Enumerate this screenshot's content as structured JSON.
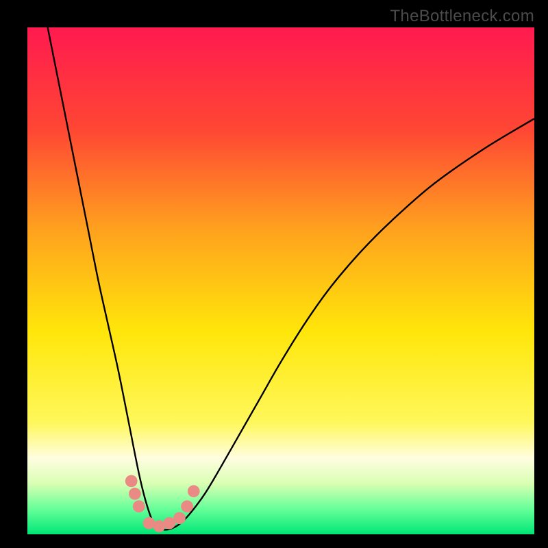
{
  "watermark": "TheBottleneck.com",
  "chart_data": {
    "type": "line",
    "title": "",
    "xlabel": "",
    "ylabel": "",
    "xlim": [
      0,
      100
    ],
    "ylim": [
      0,
      100
    ],
    "grid": false,
    "legend": false,
    "background_gradient": {
      "stops": [
        {
          "pos": 0.0,
          "color": "#ff1a4f"
        },
        {
          "pos": 0.2,
          "color": "#ff4634"
        },
        {
          "pos": 0.4,
          "color": "#ffa21e"
        },
        {
          "pos": 0.6,
          "color": "#ffe60a"
        },
        {
          "pos": 0.78,
          "color": "#fff85c"
        },
        {
          "pos": 0.85,
          "color": "#fffde0"
        },
        {
          "pos": 0.9,
          "color": "#d9ffb3"
        },
        {
          "pos": 0.95,
          "color": "#66ff99"
        },
        {
          "pos": 1.0,
          "color": "#00e676"
        }
      ]
    },
    "series": [
      {
        "name": "bottleneck-curve",
        "color": "#000000",
        "x": [
          4,
          6,
          8,
          10,
          12,
          14,
          16,
          18,
          20,
          22,
          23.5,
          25,
          26.5,
          28,
          30,
          32,
          35,
          38,
          42,
          46,
          50,
          55,
          60,
          66,
          72,
          80,
          90,
          100
        ],
        "y": [
          100,
          90,
          80,
          70,
          60,
          50,
          41,
          32,
          22,
          12,
          6,
          2,
          1,
          1,
          2,
          4,
          8,
          13,
          20,
          27,
          34,
          42,
          49,
          56,
          62,
          69,
          76,
          82
        ]
      }
    ],
    "markers": {
      "name": "optimal-dots",
      "color": "#e98b84",
      "radius_pct": 1.2,
      "points": [
        {
          "x": 20.5,
          "y": 10.5
        },
        {
          "x": 21.2,
          "y": 8.0
        },
        {
          "x": 22.0,
          "y": 5.5
        },
        {
          "x": 24.0,
          "y": 2.2
        },
        {
          "x": 26.0,
          "y": 1.6
        },
        {
          "x": 28.0,
          "y": 2.2
        },
        {
          "x": 30.0,
          "y": 3.2
        },
        {
          "x": 31.5,
          "y": 5.5
        },
        {
          "x": 32.8,
          "y": 8.5
        }
      ]
    }
  }
}
